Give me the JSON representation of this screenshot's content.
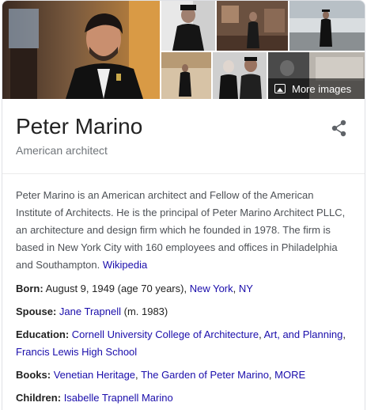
{
  "gallery": {
    "more_images_label": "More images"
  },
  "entity": {
    "title": "Peter Marino",
    "subtitle": "American architect"
  },
  "description": {
    "text": "Peter Marino is an American architect and Fellow of the American Institute of Architects. He is the principal of Peter Marino Architect PLLC, an architecture and design firm which he founded in 1978. The firm is based in New York City with 160 employees and offices in Philadelphia and Southampton.",
    "source_link": "Wikipedia"
  },
  "facts": {
    "born": {
      "label": "Born:",
      "text": "August 9, 1949 (age 70 years),",
      "link1": "New York",
      "sep": ",",
      "link2": "NY"
    },
    "spouse": {
      "label": "Spouse:",
      "link": "Jane Trapnell",
      "text": "(m. 1983)"
    },
    "education": {
      "label": "Education:",
      "link1": "Cornell University College of Architecture",
      "sep1": ",",
      "link2": "Art, and Planning",
      "sep2": ",",
      "link3": "Francis Lewis High School"
    },
    "books": {
      "label": "Books:",
      "link1": "Venetian Heritage",
      "sep1": ",",
      "link2": "The Garden of Peter Marino",
      "sep2": ",",
      "link3": "MORE"
    },
    "children": {
      "label": "Children:",
      "link": "Isabelle Trapnell Marino"
    }
  },
  "colors": {
    "link": "#1a0dab",
    "secondary_text": "#70757a",
    "body_text": "#4d5156"
  }
}
